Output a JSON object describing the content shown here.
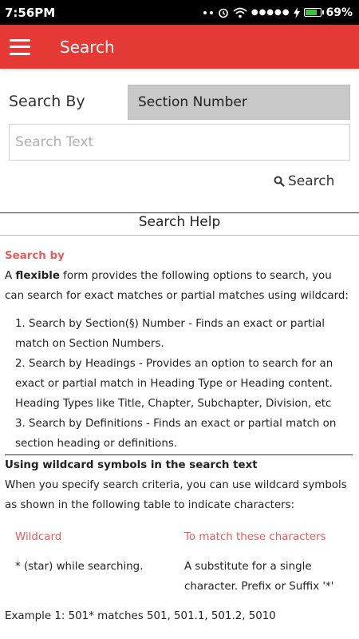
{
  "statusbar": {
    "time": "7:56PM",
    "signal_dots": "●●●●●",
    "battery_percent_text": "69%",
    "battery_level": 0.69
  },
  "appbar": {
    "title": "Search"
  },
  "search_form": {
    "search_by_label": "Search By",
    "search_by_selected": "Section Number",
    "search_text_placeholder": "Search Text",
    "search_button_label": "Search"
  },
  "help": {
    "title": "Search Help",
    "search_by_heading": "Search by",
    "intro_prefix": "A ",
    "intro_bold": "flexible",
    "intro_rest": " form provides the following options to search, you can search for exact matches or partial matches using wildcard:",
    "options": [
      "1. Search by Section(§) Number - Finds an exact or partial match on Section Numbers.",
      "2. Search by Headings - Provides an option to search for an exact or partial match in Heading Type or Heading  content. Heading Types like Title, Chapter, Subchapter, Division, etc",
      "3. Search by Definitions - Finds an exact or partial match on section heading or definitions."
    ],
    "wildcard_heading": "Using wildcard symbols in the search text",
    "wildcard_intro": "When you specify search criteria, you can use wildcard symbols as shown in the following table to indicate characters:",
    "table": {
      "col1_header": "Wildcard",
      "col2_header": "To match these characters",
      "rows": [
        {
          "wildcard": "* (star) while searching.",
          "match": "A substitute for a single character. Prefix or Suffix '*'"
        }
      ]
    },
    "example1": "Example 1: 501* matches 501, 501.1, 501.2, 5010"
  },
  "colors": {
    "appbar": "#e53935",
    "accent_text": "#e85c5c",
    "select_bg": "#c8c8c8",
    "battery_fill": "#3fbf3f"
  }
}
